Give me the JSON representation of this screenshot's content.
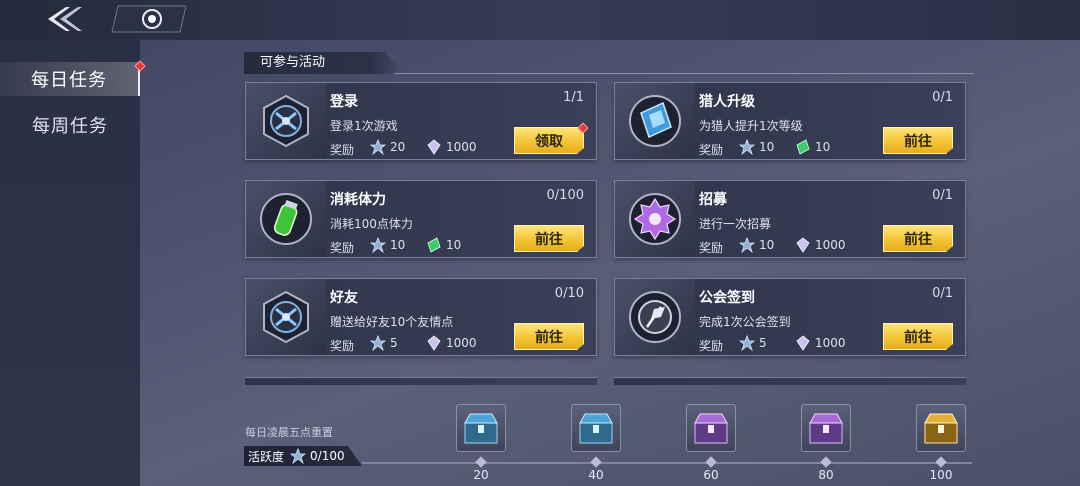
{
  "nav": {
    "back_icon": "double-chevron-left-icon",
    "home_icon": "target-icon"
  },
  "sidebar": {
    "tabs": [
      {
        "label": "每日任务",
        "active": true,
        "badge": true
      },
      {
        "label": "每周任务",
        "active": false,
        "badge": false
      }
    ]
  },
  "section": {
    "title": "可参与活动"
  },
  "reward_label": "奖励",
  "tasks": [
    {
      "title": "登录",
      "progress": "1/1",
      "desc": "登录1次游戏",
      "icon": "badge-emblem-icon",
      "rewards": [
        {
          "icon": "activity-star-icon",
          "value": "20"
        },
        {
          "icon": "crystal-icon",
          "value": "1000"
        }
      ],
      "button": "领取",
      "badge": true
    },
    {
      "title": "猎人升级",
      "progress": "0/1",
      "desc": "为猎人提升1次等级",
      "icon": "book-icon",
      "rewards": [
        {
          "icon": "activity-star-icon",
          "value": "10"
        },
        {
          "icon": "green-ticket-icon",
          "value": "10"
        }
      ],
      "button": "前往",
      "badge": false
    },
    {
      "title": "消耗体力",
      "progress": "0/100",
      "desc": "消耗100点体力",
      "icon": "energy-vial-icon",
      "rewards": [
        {
          "icon": "activity-star-icon",
          "value": "10"
        },
        {
          "icon": "green-ticket-icon",
          "value": "10"
        }
      ],
      "button": "前往",
      "badge": false
    },
    {
      "title": "招募",
      "progress": "0/1",
      "desc": "进行一次招募",
      "icon": "purple-gear-icon",
      "rewards": [
        {
          "icon": "activity-star-icon",
          "value": "10"
        },
        {
          "icon": "crystal-icon",
          "value": "1000"
        }
      ],
      "button": "前往",
      "badge": false
    },
    {
      "title": "好友",
      "progress": "0/10",
      "desc": "赠送给好友10个友情点",
      "icon": "badge-emblem-icon",
      "rewards": [
        {
          "icon": "activity-star-icon",
          "value": "5"
        },
        {
          "icon": "crystal-icon",
          "value": "1000"
        }
      ],
      "button": "前往",
      "badge": false
    },
    {
      "title": "公会签到",
      "progress": "0/1",
      "desc": "完成1次公会签到",
      "icon": "guild-flag-icon",
      "rewards": [
        {
          "icon": "activity-star-icon",
          "value": "5"
        },
        {
          "icon": "crystal-icon",
          "value": "1000"
        }
      ],
      "button": "前往",
      "badge": false
    }
  ],
  "footer": {
    "reset_text": "每日凌晨五点重置",
    "activity_label": "活跃度",
    "activity_value": "0/100",
    "milestones": [
      {
        "label": "20",
        "chest": "blue"
      },
      {
        "label": "40",
        "chest": "blue"
      },
      {
        "label": "60",
        "chest": "purple"
      },
      {
        "label": "80",
        "chest": "purple"
      },
      {
        "label": "100",
        "chest": "gold"
      }
    ]
  },
  "colors": {
    "button_yellow": "#f3c536",
    "badge_red": "#e23d3d",
    "chest_blue": "#4aa6d8",
    "chest_purple": "#a86ad8",
    "chest_gold": "#e4b03a"
  }
}
